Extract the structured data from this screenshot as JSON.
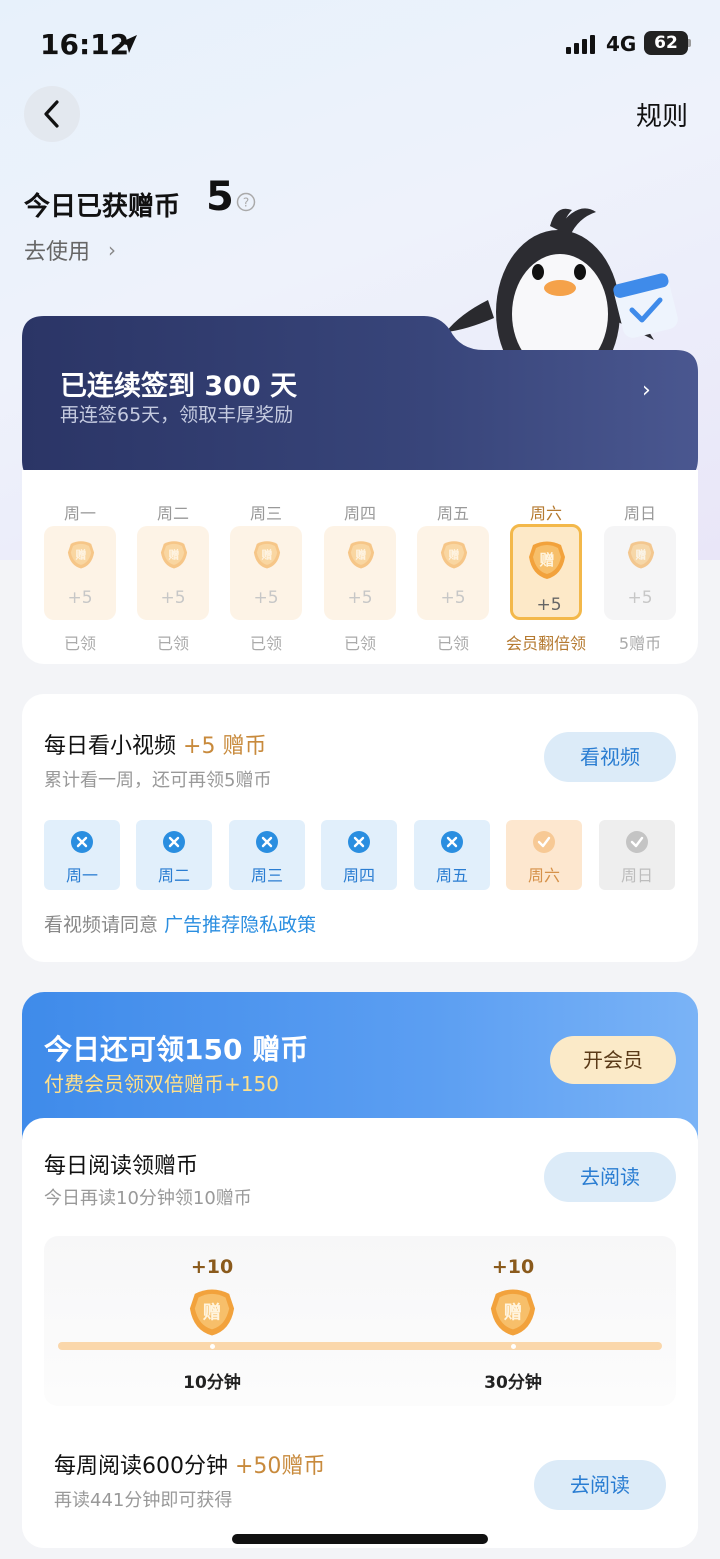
{
  "status_bar": {
    "time": "16:12",
    "network": "4G",
    "battery": "62"
  },
  "header": {
    "back_icon": "chevron-left-icon",
    "rules_label": "规则"
  },
  "coins": {
    "title": "今日已获赠币",
    "value": "5",
    "use_label": "去使用",
    "use_chevron": "›"
  },
  "checkin": {
    "title": "已连续签到 300 天",
    "subtitle": "再连签65天，领取丰厚奖励",
    "arrow": "›"
  },
  "week": {
    "days": [
      {
        "name": "周一",
        "amount": "+5",
        "status": "已领"
      },
      {
        "name": "周二",
        "amount": "+5",
        "status": "已领"
      },
      {
        "name": "周三",
        "amount": "+5",
        "status": "已领"
      },
      {
        "name": "周四",
        "amount": "+5",
        "status": "已领"
      },
      {
        "name": "周五",
        "amount": "+5",
        "status": "已领"
      },
      {
        "name": "周六",
        "amount": "+5",
        "status": "会员翻倍领"
      },
      {
        "name": "周日",
        "amount": "+5",
        "status": "5赠币"
      }
    ]
  },
  "video_task": {
    "title": "每日看小视频",
    "bonus": "+5 赠币",
    "subtitle": "累计看一周，还可再领5赠币",
    "button": "看视频",
    "days": [
      "周一",
      "周二",
      "周三",
      "周四",
      "周五",
      "周六",
      "周日"
    ],
    "privacy_prefix": "看视频请同意",
    "privacy_link": "广告推荐隐私政策"
  },
  "member": {
    "title": "今日还可领150 赠币",
    "subtitle": "付费会员领双倍赠币+150",
    "button": "开会员"
  },
  "daily_read": {
    "title": "每日阅读领赠币",
    "subtitle": "今日再读10分钟领10赠币",
    "button": "去阅读",
    "milestones": [
      {
        "bonus": "+10",
        "label": "10分钟"
      },
      {
        "bonus": "+10",
        "label": "30分钟"
      }
    ]
  },
  "weekly_read": {
    "title": "每周阅读600分钟",
    "bonus": "+50赠币",
    "subtitle": "再读441分钟即可获得",
    "button": "去阅读"
  },
  "colors": {
    "accent_blue": "#2a7dd2",
    "banner_navy": "#2f3a6b",
    "gold": "#c88a3c"
  }
}
